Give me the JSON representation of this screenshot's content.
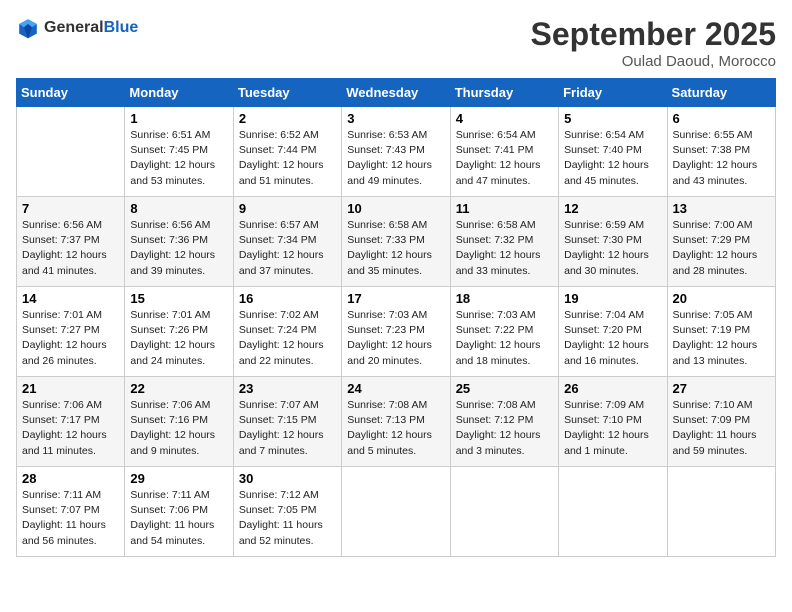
{
  "header": {
    "logo_general": "General",
    "logo_blue": "Blue",
    "month_title": "September 2025",
    "subtitle": "Oulad Daoud, Morocco"
  },
  "days_of_week": [
    "Sunday",
    "Monday",
    "Tuesday",
    "Wednesday",
    "Thursday",
    "Friday",
    "Saturday"
  ],
  "weeks": [
    [
      {
        "day": "",
        "sunrise": "",
        "sunset": "",
        "daylight": ""
      },
      {
        "day": "1",
        "sunrise": "Sunrise: 6:51 AM",
        "sunset": "Sunset: 7:45 PM",
        "daylight": "Daylight: 12 hours and 53 minutes."
      },
      {
        "day": "2",
        "sunrise": "Sunrise: 6:52 AM",
        "sunset": "Sunset: 7:44 PM",
        "daylight": "Daylight: 12 hours and 51 minutes."
      },
      {
        "day": "3",
        "sunrise": "Sunrise: 6:53 AM",
        "sunset": "Sunset: 7:43 PM",
        "daylight": "Daylight: 12 hours and 49 minutes."
      },
      {
        "day": "4",
        "sunrise": "Sunrise: 6:54 AM",
        "sunset": "Sunset: 7:41 PM",
        "daylight": "Daylight: 12 hours and 47 minutes."
      },
      {
        "day": "5",
        "sunrise": "Sunrise: 6:54 AM",
        "sunset": "Sunset: 7:40 PM",
        "daylight": "Daylight: 12 hours and 45 minutes."
      },
      {
        "day": "6",
        "sunrise": "Sunrise: 6:55 AM",
        "sunset": "Sunset: 7:38 PM",
        "daylight": "Daylight: 12 hours and 43 minutes."
      }
    ],
    [
      {
        "day": "7",
        "sunrise": "Sunrise: 6:56 AM",
        "sunset": "Sunset: 7:37 PM",
        "daylight": "Daylight: 12 hours and 41 minutes."
      },
      {
        "day": "8",
        "sunrise": "Sunrise: 6:56 AM",
        "sunset": "Sunset: 7:36 PM",
        "daylight": "Daylight: 12 hours and 39 minutes."
      },
      {
        "day": "9",
        "sunrise": "Sunrise: 6:57 AM",
        "sunset": "Sunset: 7:34 PM",
        "daylight": "Daylight: 12 hours and 37 minutes."
      },
      {
        "day": "10",
        "sunrise": "Sunrise: 6:58 AM",
        "sunset": "Sunset: 7:33 PM",
        "daylight": "Daylight: 12 hours and 35 minutes."
      },
      {
        "day": "11",
        "sunrise": "Sunrise: 6:58 AM",
        "sunset": "Sunset: 7:32 PM",
        "daylight": "Daylight: 12 hours and 33 minutes."
      },
      {
        "day": "12",
        "sunrise": "Sunrise: 6:59 AM",
        "sunset": "Sunset: 7:30 PM",
        "daylight": "Daylight: 12 hours and 30 minutes."
      },
      {
        "day": "13",
        "sunrise": "Sunrise: 7:00 AM",
        "sunset": "Sunset: 7:29 PM",
        "daylight": "Daylight: 12 hours and 28 minutes."
      }
    ],
    [
      {
        "day": "14",
        "sunrise": "Sunrise: 7:01 AM",
        "sunset": "Sunset: 7:27 PM",
        "daylight": "Daylight: 12 hours and 26 minutes."
      },
      {
        "day": "15",
        "sunrise": "Sunrise: 7:01 AM",
        "sunset": "Sunset: 7:26 PM",
        "daylight": "Daylight: 12 hours and 24 minutes."
      },
      {
        "day": "16",
        "sunrise": "Sunrise: 7:02 AM",
        "sunset": "Sunset: 7:24 PM",
        "daylight": "Daylight: 12 hours and 22 minutes."
      },
      {
        "day": "17",
        "sunrise": "Sunrise: 7:03 AM",
        "sunset": "Sunset: 7:23 PM",
        "daylight": "Daylight: 12 hours and 20 minutes."
      },
      {
        "day": "18",
        "sunrise": "Sunrise: 7:03 AM",
        "sunset": "Sunset: 7:22 PM",
        "daylight": "Daylight: 12 hours and 18 minutes."
      },
      {
        "day": "19",
        "sunrise": "Sunrise: 7:04 AM",
        "sunset": "Sunset: 7:20 PM",
        "daylight": "Daylight: 12 hours and 16 minutes."
      },
      {
        "day": "20",
        "sunrise": "Sunrise: 7:05 AM",
        "sunset": "Sunset: 7:19 PM",
        "daylight": "Daylight: 12 hours and 13 minutes."
      }
    ],
    [
      {
        "day": "21",
        "sunrise": "Sunrise: 7:06 AM",
        "sunset": "Sunset: 7:17 PM",
        "daylight": "Daylight: 12 hours and 11 minutes."
      },
      {
        "day": "22",
        "sunrise": "Sunrise: 7:06 AM",
        "sunset": "Sunset: 7:16 PM",
        "daylight": "Daylight: 12 hours and 9 minutes."
      },
      {
        "day": "23",
        "sunrise": "Sunrise: 7:07 AM",
        "sunset": "Sunset: 7:15 PM",
        "daylight": "Daylight: 12 hours and 7 minutes."
      },
      {
        "day": "24",
        "sunrise": "Sunrise: 7:08 AM",
        "sunset": "Sunset: 7:13 PM",
        "daylight": "Daylight: 12 hours and 5 minutes."
      },
      {
        "day": "25",
        "sunrise": "Sunrise: 7:08 AM",
        "sunset": "Sunset: 7:12 PM",
        "daylight": "Daylight: 12 hours and 3 minutes."
      },
      {
        "day": "26",
        "sunrise": "Sunrise: 7:09 AM",
        "sunset": "Sunset: 7:10 PM",
        "daylight": "Daylight: 12 hours and 1 minute."
      },
      {
        "day": "27",
        "sunrise": "Sunrise: 7:10 AM",
        "sunset": "Sunset: 7:09 PM",
        "daylight": "Daylight: 11 hours and 59 minutes."
      }
    ],
    [
      {
        "day": "28",
        "sunrise": "Sunrise: 7:11 AM",
        "sunset": "Sunset: 7:07 PM",
        "daylight": "Daylight: 11 hours and 56 minutes."
      },
      {
        "day": "29",
        "sunrise": "Sunrise: 7:11 AM",
        "sunset": "Sunset: 7:06 PM",
        "daylight": "Daylight: 11 hours and 54 minutes."
      },
      {
        "day": "30",
        "sunrise": "Sunrise: 7:12 AM",
        "sunset": "Sunset: 7:05 PM",
        "daylight": "Daylight: 11 hours and 52 minutes."
      },
      {
        "day": "",
        "sunrise": "",
        "sunset": "",
        "daylight": ""
      },
      {
        "day": "",
        "sunrise": "",
        "sunset": "",
        "daylight": ""
      },
      {
        "day": "",
        "sunrise": "",
        "sunset": "",
        "daylight": ""
      },
      {
        "day": "",
        "sunrise": "",
        "sunset": "",
        "daylight": ""
      }
    ]
  ]
}
